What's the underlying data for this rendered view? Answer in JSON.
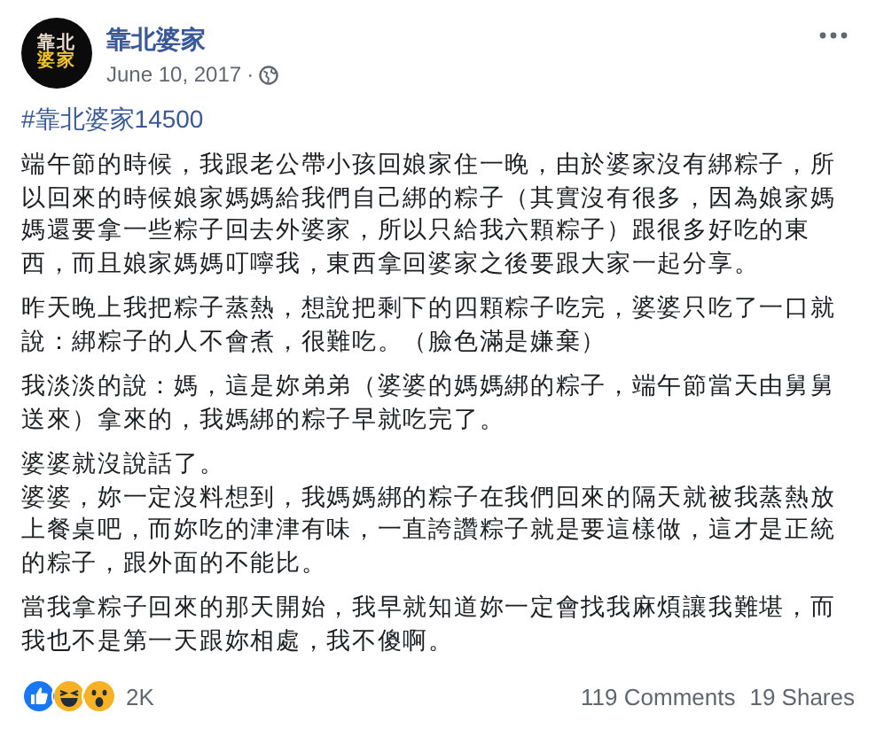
{
  "post": {
    "page_name": "靠北婆家",
    "avatar_text": [
      "靠北",
      "婆家"
    ],
    "date": "June 10, 2017",
    "separator": "·",
    "hashtag": "#靠北婆家14500",
    "paragraphs": [
      "端午節的時候，我跟老公帶小孩回娘家住一晚，由於婆家沒有綁粽子，所以回來的時候娘家媽媽給我們自己綁的粽子（其實沒有很多，因為娘家媽媽還要拿一些粽子回去外婆家，所以只給我六顆粽子）跟很多好吃的東西，而且娘家媽媽叮嚀我，東西拿回婆家之後要跟大家一起分享。",
      "昨天晚上我把粽子蒸熱，想說把剩下的四顆粽子吃完，婆婆只吃了一口就說：綁粽子的人不會煮，很難吃。（臉色滿是嫌棄）",
      "我淡淡的說：媽，這是妳弟弟（婆婆的媽媽綁的粽子，端午節當天由舅舅送來）拿來的，我媽綁的粽子早就吃完了。",
      "婆婆就沒說話了。",
      "婆婆，妳一定沒料想到，我媽媽綁的粽子在我們回來的隔天就被我蒸熱放上餐桌吧，而妳吃的津津有味，一直誇讚粽子就是要這樣做，這才是正統的粽子，跟外面的不能比。",
      "當我拿粽子回來的那天開始，我早就知道妳一定會找我麻煩讓我難堪，而我也不是第一天跟妳相處，我不傻啊。"
    ],
    "reactions": [
      {
        "kind": "like"
      },
      {
        "kind": "haha"
      },
      {
        "kind": "wow"
      }
    ],
    "reaction_count": "2K",
    "comments": "119 Comments",
    "shares": "19 Shares"
  }
}
